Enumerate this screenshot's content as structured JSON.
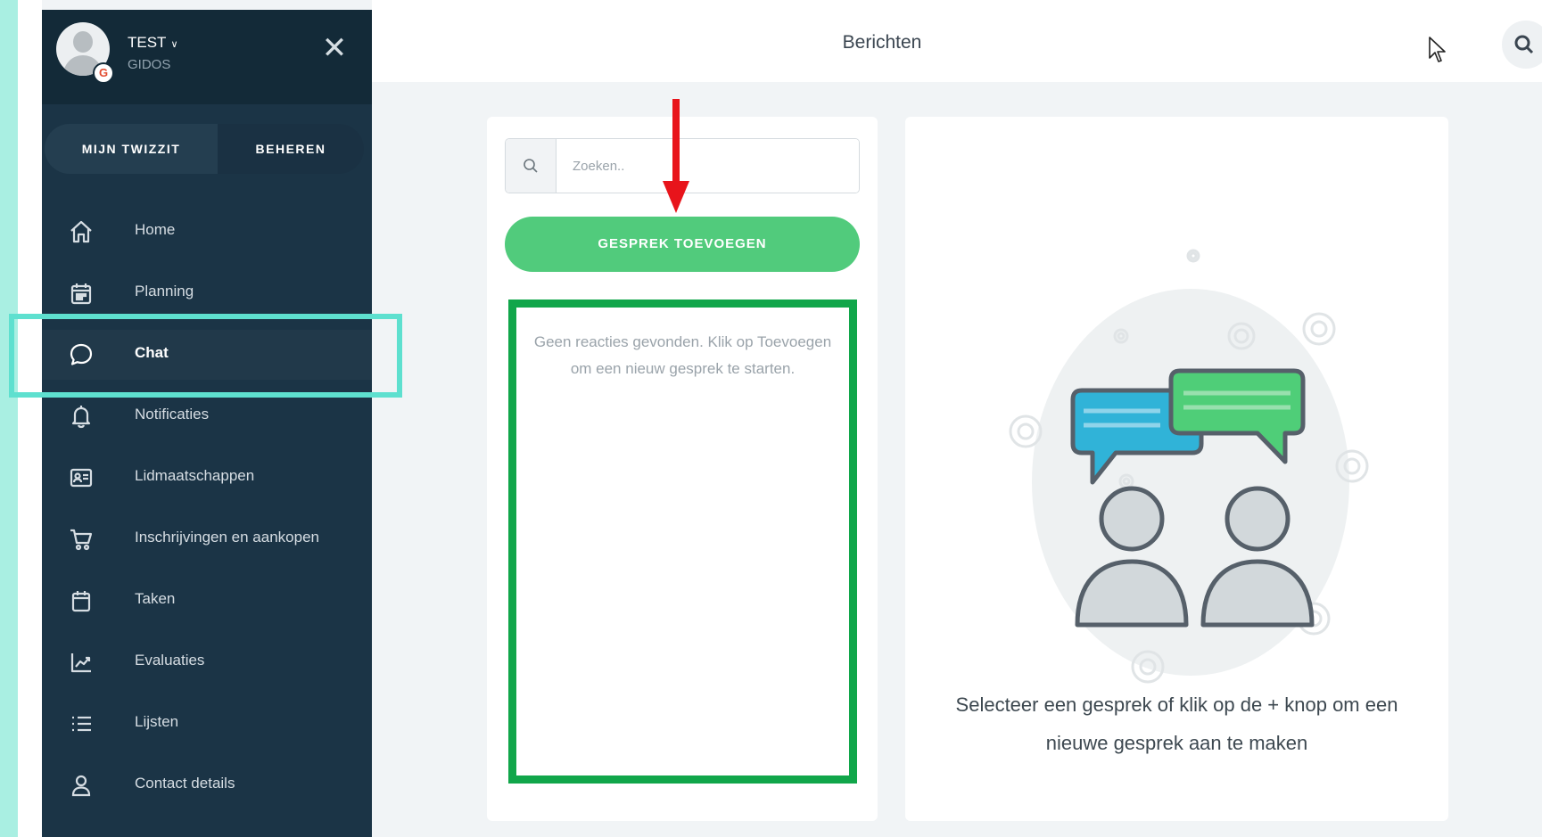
{
  "user": {
    "name": "TEST",
    "org": "GIDOS",
    "badge": "G"
  },
  "segmented": {
    "mine": "MIJN TWIZZIT",
    "manage": "BEHEREN"
  },
  "nav": {
    "items": [
      {
        "label": "Home",
        "icon": "home-icon"
      },
      {
        "label": "Planning",
        "icon": "calendar-icon"
      },
      {
        "label": "Chat",
        "icon": "chat-bubble-icon",
        "active": true
      },
      {
        "label": "Notificaties",
        "icon": "bell-icon"
      },
      {
        "label": "Lidmaatschappen",
        "icon": "id-card-icon"
      },
      {
        "label": "Inschrijvingen en aankopen",
        "icon": "cart-icon"
      },
      {
        "label": "Taken",
        "icon": "task-calendar-icon"
      },
      {
        "label": "Evaluaties",
        "icon": "chart-icon"
      },
      {
        "label": "Lijsten",
        "icon": "list-icon"
      },
      {
        "label": "Contact details",
        "icon": "user-icon"
      }
    ]
  },
  "header": {
    "title": "Berichten"
  },
  "messages": {
    "search_placeholder": "Zoeken..",
    "add_button": "GESPREK TOEVOEGEN",
    "empty_text": "Geen reacties gevonden. Klik op Toevoegen om een nieuw gesprek te starten."
  },
  "detail": {
    "select_text": "Selecteer een gesprek of klik op de + knop om een nieuwe gesprek aan te maken"
  },
  "colors": {
    "sidebar": "#1b3446",
    "accent_green": "#51cb7c",
    "highlight_teal": "#5ee0cf",
    "highlight_green": "#11a64a",
    "arrow_red": "#e8141b"
  }
}
